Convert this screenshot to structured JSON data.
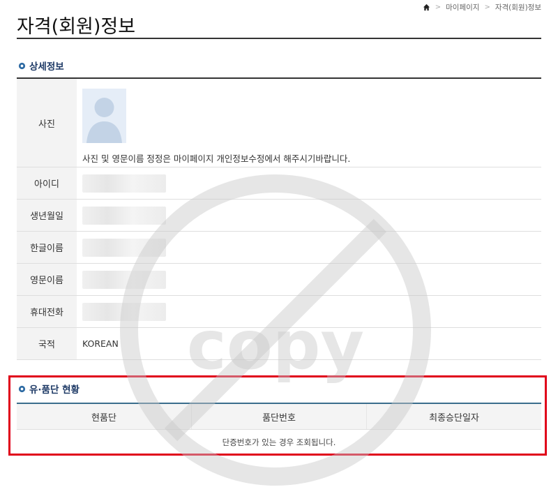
{
  "header": {
    "title": "자격(회원)정보",
    "breadcrumb": [
      "마이페이지",
      "자격(회원)정보"
    ]
  },
  "detail_section": {
    "title": "상세정보",
    "rows": [
      {
        "label": "사진",
        "note": "사진 및 영문이름 정정은 마이페이지 개인정보수정에서 해주시기바랍니다."
      },
      {
        "label": "아이디",
        "value": ""
      },
      {
        "label": "생년월일",
        "value": ""
      },
      {
        "label": "한글이름",
        "value": ""
      },
      {
        "label": "영문이름",
        "value": ""
      },
      {
        "label": "휴대전화",
        "value": ""
      },
      {
        "label": "국적",
        "value": "KOREAN"
      }
    ]
  },
  "status_section": {
    "title": "유·품단 현황",
    "columns": [
      "현품단",
      "품단번호",
      "최종승단일자"
    ],
    "empty_message": "단증번호가 있는 경우 조회됩니다."
  },
  "watermark_text": "copy"
}
